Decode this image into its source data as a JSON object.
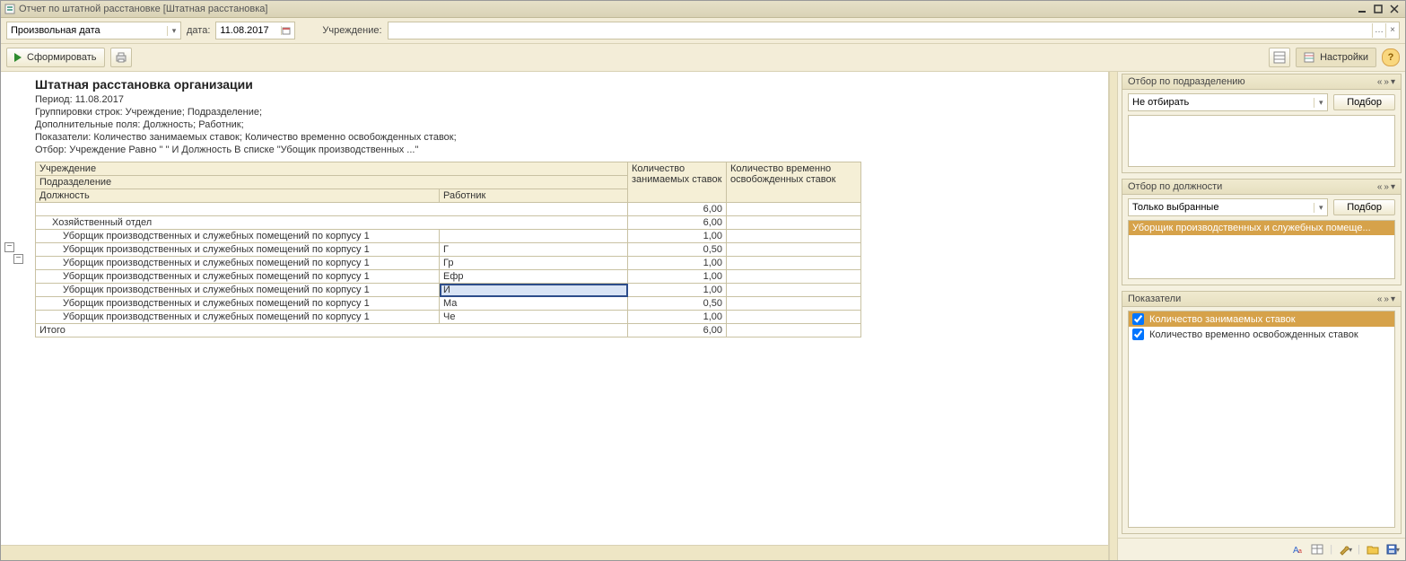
{
  "window": {
    "title": "Отчет по штатной расстановке [Штатная расстановка]"
  },
  "toolbar1": {
    "period_mode": "Произвольная дата",
    "date_label": "дата:",
    "date_value": "11.08.2017",
    "institution_label": "Учреждение:",
    "institution_value": ""
  },
  "toolbar2": {
    "generate_label": "Сформировать",
    "settings_label": "Настройки"
  },
  "report": {
    "title": "Штатная расстановка организации",
    "period_line": "Период: 11.08.2017",
    "groupings_line": "Группировки строк: Учреждение; Подразделение;",
    "extra_fields_line": "Дополнительные поля: Должность; Работник;",
    "indicators_line": "Показатели: Количество занимаемых ставок; Количество временно освобожденных ставок;",
    "filter_line": "Отбор: Учреждение Равно \"                         \" И Должность В списке \"Убощик производственных ...\"",
    "headers": {
      "institution": "Учреждение",
      "subdivision": "Подразделение",
      "position": "Должность",
      "worker": "Работник",
      "col1": "Количество занимаемых ставок",
      "col2": "Количество временно освобожденных ставок"
    },
    "group1": {
      "col1": "6,00",
      "col2": ""
    },
    "group2": {
      "name": "Хозяйственный отдел",
      "col1": "6,00",
      "col2": ""
    },
    "rows": [
      {
        "position": "Уборщик производственных и служебных помещений по корпусу 1",
        "worker": "",
        "col1": "1,00",
        "col2": ""
      },
      {
        "position": "Уборщик производственных и служебных помещений по корпусу 1",
        "worker": "Г",
        "col1": "0,50",
        "col2": ""
      },
      {
        "position": "Уборщик производственных и служебных помещений по корпусу 1",
        "worker": "Гр",
        "col1": "1,00",
        "col2": ""
      },
      {
        "position": "Уборщик производственных и служебных помещений по корпусу 1",
        "worker": "Ефр",
        "col1": "1,00",
        "col2": ""
      },
      {
        "position": "Уборщик производственных и служебных помещений по корпусу 1",
        "worker": "И",
        "col1": "1,00",
        "col2": ""
      },
      {
        "position": "Уборщик производственных и служебных помещений по корпусу 1",
        "worker": "Ма",
        "col1": "0,50",
        "col2": ""
      },
      {
        "position": "Уборщик производственных и служебных помещений по корпусу 1",
        "worker": "Че",
        "col1": "1,00",
        "col2": ""
      }
    ],
    "total": {
      "label": "Итого",
      "col1": "6,00",
      "col2": ""
    }
  },
  "right": {
    "panel_subdiv": {
      "title": "Отбор по подразделению",
      "mode": "Не отбирать",
      "pick_label": "Подбор"
    },
    "panel_position": {
      "title": "Отбор по должности",
      "mode": "Только выбранные",
      "pick_label": "Подбор",
      "item": "Уборщик производственных и служебных помеще..."
    },
    "panel_indicators": {
      "title": "Показатели",
      "i1": "Количество занимаемых ставок",
      "i2": "Количество временно освобожденных ставок"
    }
  },
  "chart_data": {
    "type": "table",
    "title": "Штатная расстановка организации",
    "columns": [
      "Должность",
      "Работник",
      "Количество занимаемых ставок",
      "Количество временно освобожденных ставок"
    ],
    "rows": [
      [
        "Уборщик производственных и служебных помещений по корпусу 1",
        "",
        1.0,
        null
      ],
      [
        "Уборщик производственных и служебных помещений по корпусу 1",
        "Г",
        0.5,
        null
      ],
      [
        "Уборщик производственных и служебных помещений по корпусу 1",
        "Гр",
        1.0,
        null
      ],
      [
        "Уборщик производственных и служебных помещений по корпусу 1",
        "Ефр",
        1.0,
        null
      ],
      [
        "Уборщик производственных и служебных помещений по корпусу 1",
        "И",
        1.0,
        null
      ],
      [
        "Уборщик производственных и служебных помещений по корпусу 1",
        "Ма",
        0.5,
        null
      ],
      [
        "Уборщик производственных и служебных помещений по корпусу 1",
        "Че",
        1.0,
        null
      ]
    ],
    "group_totals": {
      "Хозяйственный отдел": 6.0
    },
    "grand_total": 6.0
  }
}
